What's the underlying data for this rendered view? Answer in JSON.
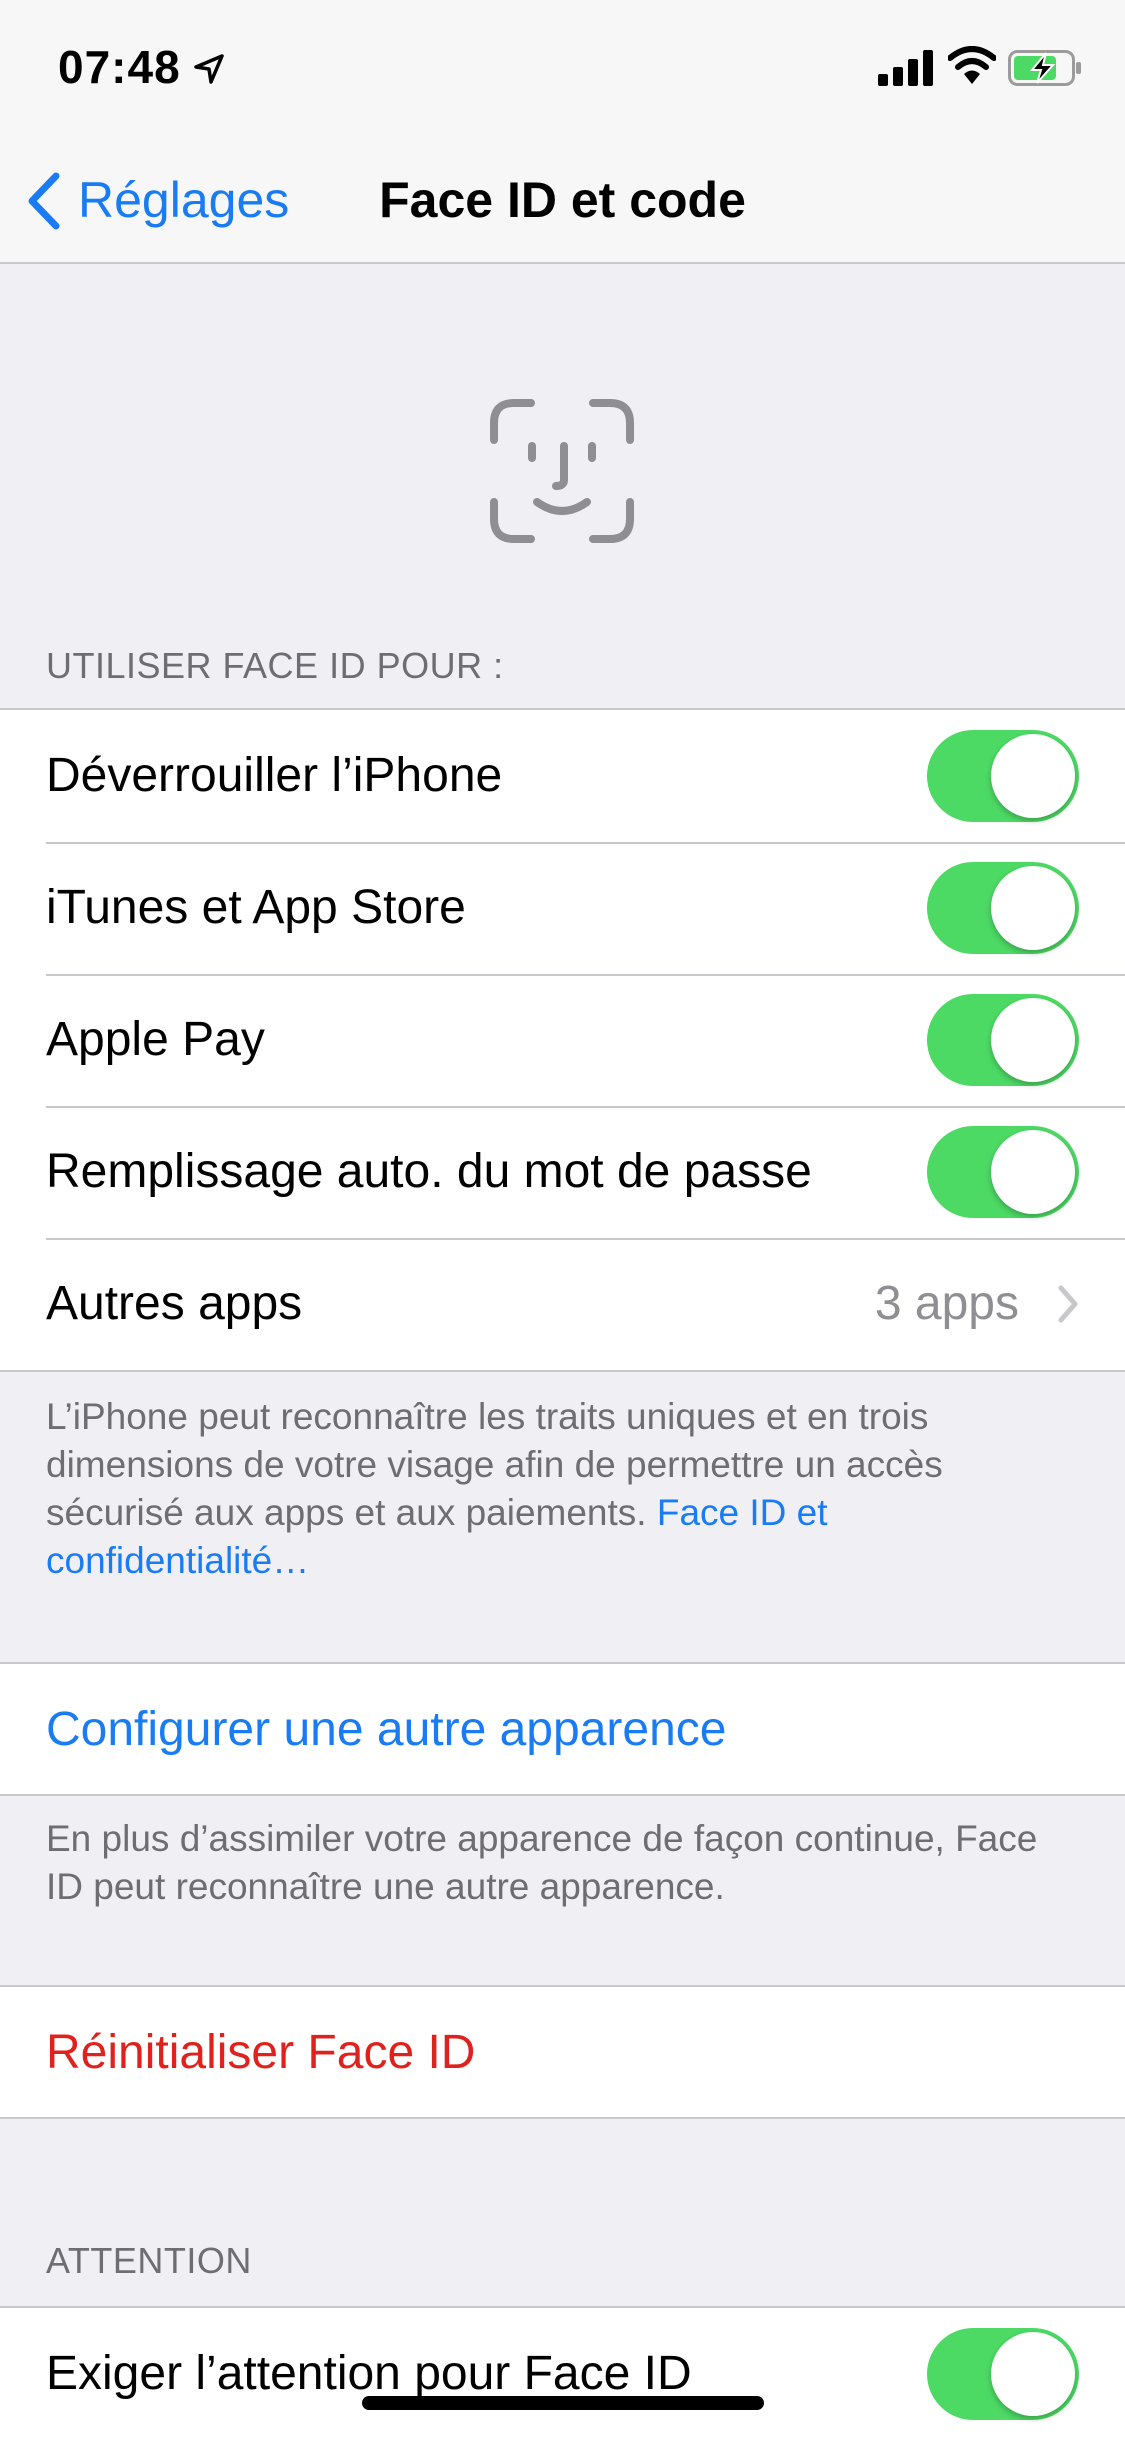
{
  "status_bar": {
    "time": "07:48",
    "battery_state": "charging"
  },
  "nav": {
    "back_label": "Réglages",
    "title": "Face ID et code"
  },
  "sections": {
    "use_faceid_header": "UTILISER FACE ID POUR :",
    "attention_header": "ATTENTION"
  },
  "use_faceid": {
    "unlock_label": "Déverrouiller l’iPhone",
    "itunes_label": "iTunes et App Store",
    "applepay_label": "Apple Pay",
    "autofill_label": "Remplissage auto. du mot de passe",
    "other_apps_label": "Autres apps",
    "other_apps_value": "3 apps",
    "toggles": {
      "unlock": true,
      "itunes": true,
      "applepay": true,
      "autofill": true
    }
  },
  "faceid_footer": {
    "text": "L’iPhone peut reconnaître les traits uniques et en trois dimensions de votre visage afin de permettre un accès sécurisé aux apps et aux paiements. ",
    "link": "Face ID et confidentialité…"
  },
  "alternate": {
    "button_label": "Configurer une autre apparence",
    "footer": "En plus d’assimiler votre apparence de façon continue, Face ID peut reconnaître une autre apparence."
  },
  "reset": {
    "button_label": "Réinitialiser Face ID"
  },
  "attention": {
    "require_label": "Exiger l’attention pour Face ID",
    "require_toggle": true
  },
  "colors": {
    "accent": "#1a7cf4",
    "destructive": "#e0221f",
    "toggle_on": "#4cd964",
    "background": "#efeff4"
  }
}
